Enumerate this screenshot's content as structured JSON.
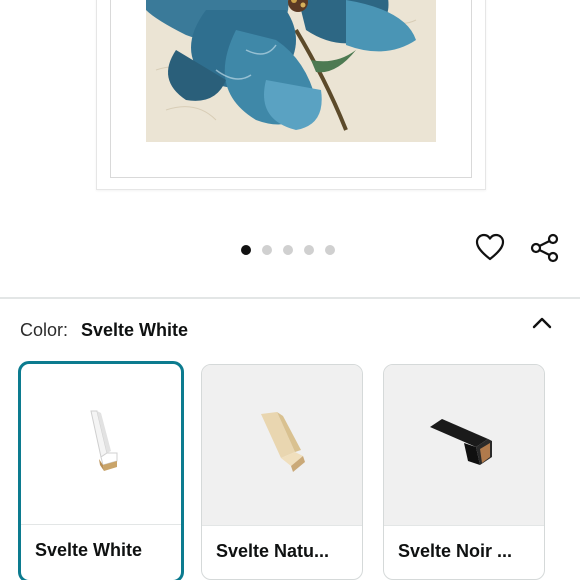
{
  "product": {
    "image_count": 5,
    "active_image_index": 0
  },
  "actions": {
    "favorite_icon": "heart-outline-icon",
    "share_icon": "share-icon"
  },
  "color_selector": {
    "label": "Color:",
    "selected_value": "Svelte White",
    "collapse_icon": "chevron-up-icon",
    "options": [
      {
        "label": "Svelte White",
        "selected": true
      },
      {
        "label": "Svelte Natu...",
        "selected": false
      },
      {
        "label": "Svelte Noir ...",
        "selected": false
      }
    ]
  },
  "colors": {
    "selected_border": "#0c7b8f",
    "active_dot": "#111111",
    "inactive_dot": "#d0d0d0"
  }
}
